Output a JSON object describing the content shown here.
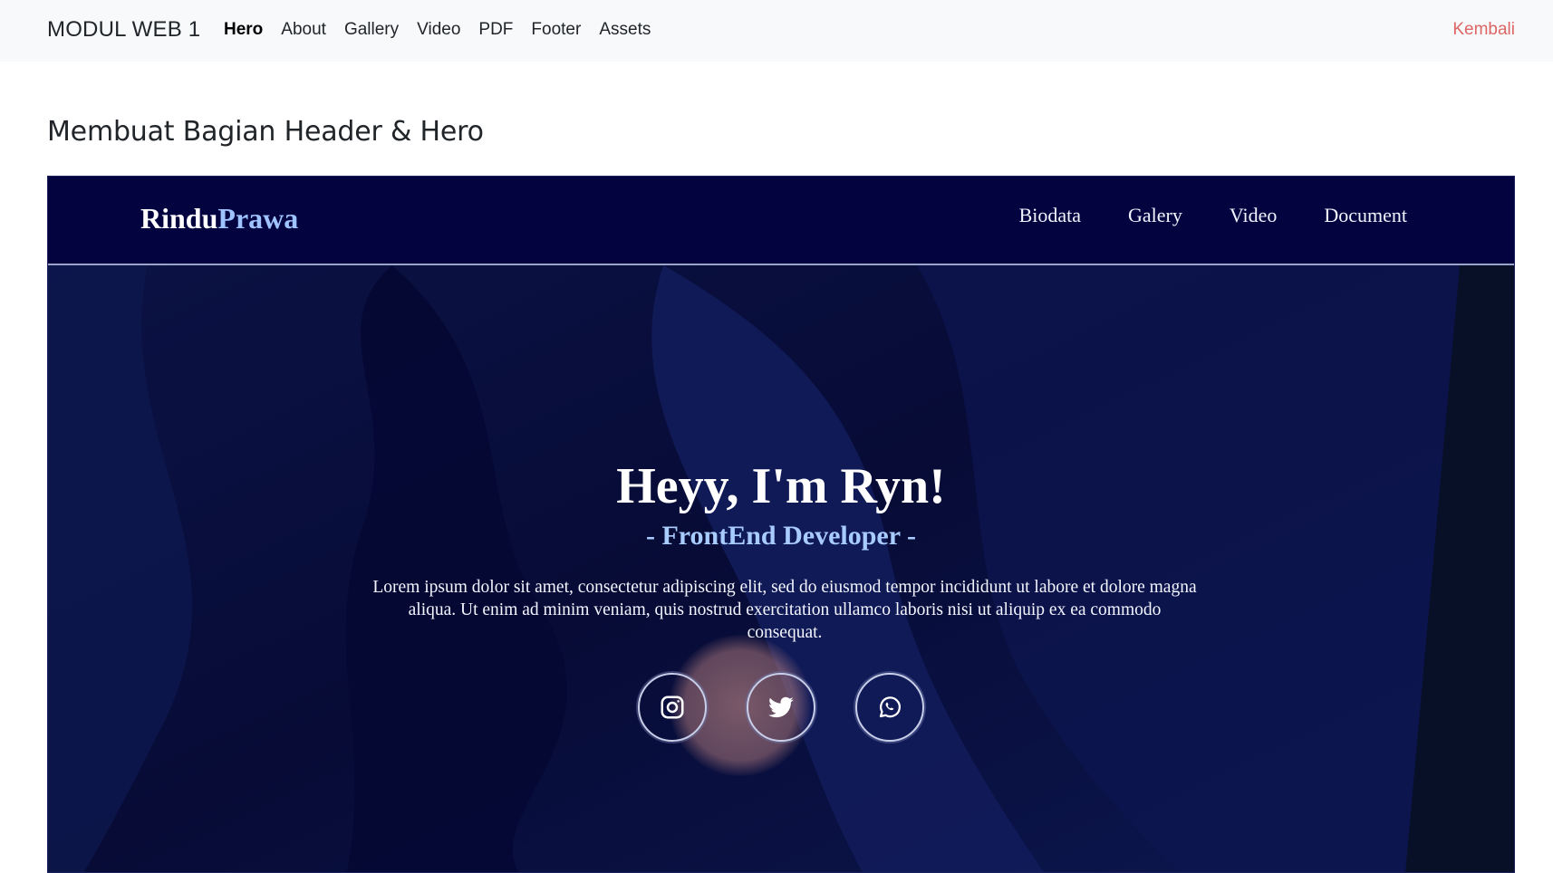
{
  "app": {
    "brand": "MODUL WEB 1",
    "nav": [
      {
        "label": "Hero",
        "active": true
      },
      {
        "label": "About",
        "active": false
      },
      {
        "label": "Gallery",
        "active": false
      },
      {
        "label": "Video",
        "active": false
      },
      {
        "label": "PDF",
        "active": false
      },
      {
        "label": "Footer",
        "active": false
      },
      {
        "label": "Assets",
        "active": false
      }
    ],
    "back_label": "Kembali"
  },
  "section": {
    "title": "Membuat Bagian Header & Hero"
  },
  "preview": {
    "logo": {
      "first": "Rindu",
      "second": "Prawa"
    },
    "nav": [
      "Biodata",
      "Galery",
      "Video",
      "Document"
    ],
    "hero": {
      "title": "Heyy, I'm Ryn!",
      "subtitle": "- FrontEnd Developer -",
      "text": "Lorem ipsum dolor sit amet, consectetur adipiscing elit, sed do eiusmod tempor incididunt ut labore et dolore magna aliqua. Ut enim ad minim veniam, quis nostrud exercitation ullamco laboris nisi ut aliquip ex ea commodo consequat."
    },
    "socials": [
      "instagram-icon",
      "twitter-icon",
      "whatsapp-icon"
    ]
  },
  "colors": {
    "accent_back": "#dc6565",
    "preview_bg": "#0a0f3a",
    "logo_accent": "#9ec3ff"
  }
}
